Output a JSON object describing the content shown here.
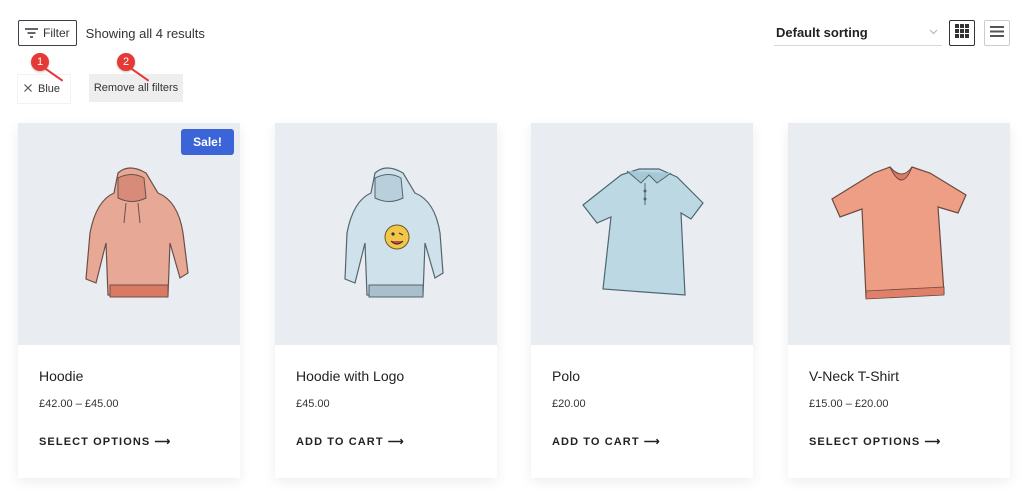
{
  "toolbar": {
    "filter_label": "Filter",
    "results_text": "Showing all 4 results",
    "sorting_label": "Default sorting"
  },
  "filters": {
    "active_chip": "Blue",
    "remove_all_label": "Remove all filters"
  },
  "annotations": [
    "1",
    "2"
  ],
  "products": [
    {
      "name": "Hoodie",
      "price": "£42.00 – £45.00",
      "action": "SELECT OPTIONS ⟶",
      "badge": "Sale!",
      "image": "hoodie-pink"
    },
    {
      "name": "Hoodie with Logo",
      "price": "£45.00",
      "action": "ADD TO CART ⟶",
      "image": "hoodie-blue-logo"
    },
    {
      "name": "Polo",
      "price": "£20.00",
      "action": "ADD TO CART ⟶",
      "image": "polo-blue"
    },
    {
      "name": "V-Neck T-Shirt",
      "price": "£15.00 – £20.00",
      "action": "SELECT OPTIONS ⟶",
      "image": "tshirt-pink"
    }
  ],
  "colors": {
    "sale_badge": "#3a64d8",
    "annotation_marker": "#e53935",
    "image_background": "#e9ecf0"
  }
}
